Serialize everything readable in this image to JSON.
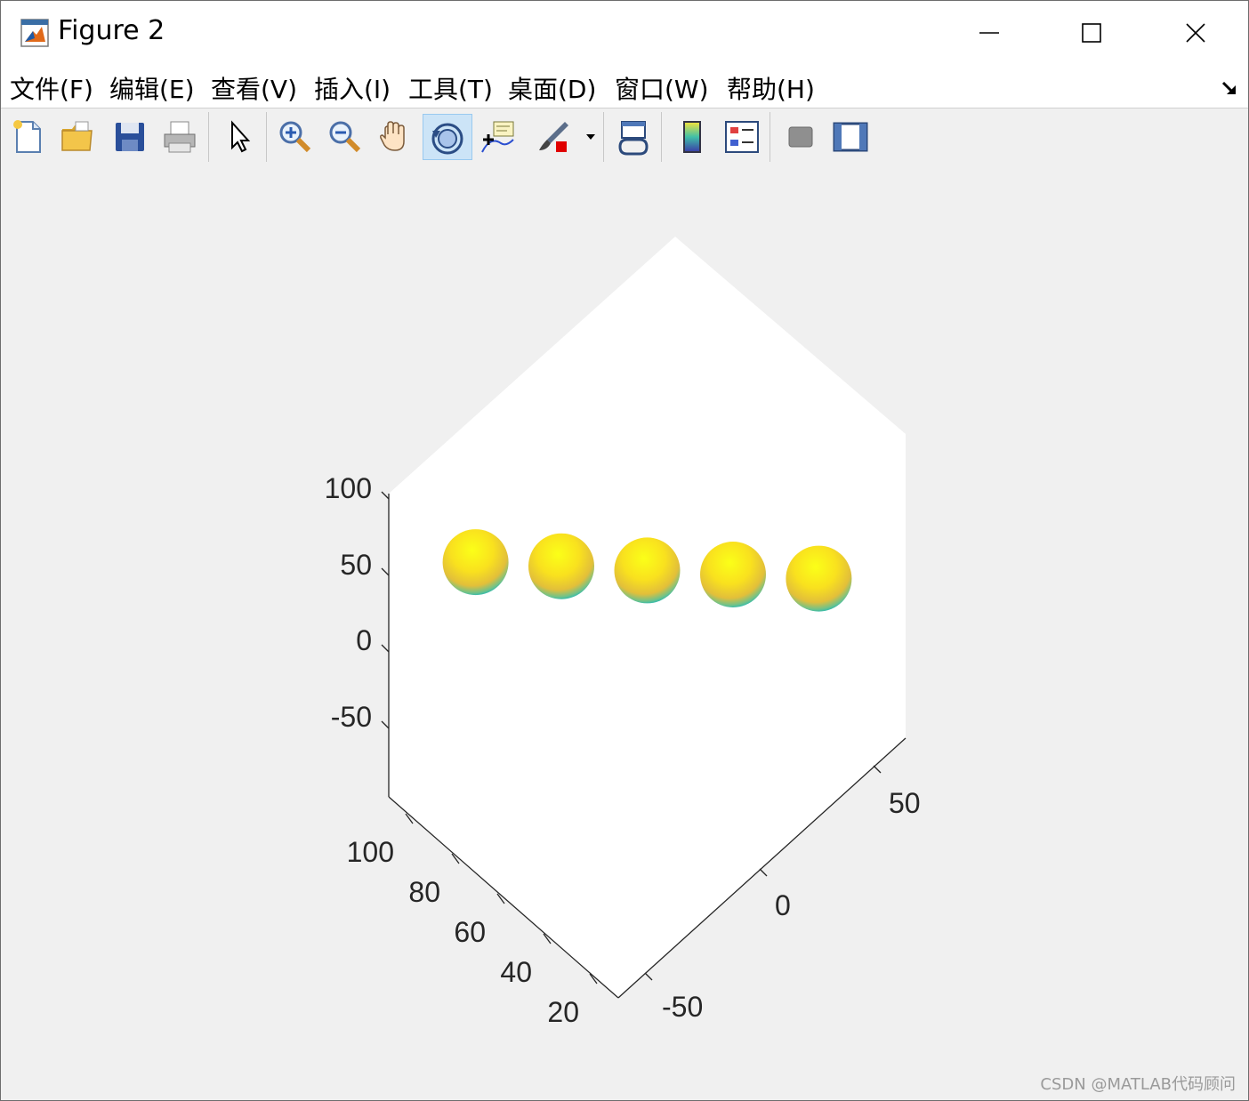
{
  "window": {
    "title": "Figure 2"
  },
  "menu": {
    "items": [
      "文件(F)",
      "编辑(E)",
      "查看(V)",
      "插入(I)",
      "工具(T)",
      "桌面(D)",
      "窗口(W)",
      "帮助(H)"
    ]
  },
  "toolbar": {
    "buttons": [
      "new-figure",
      "open-file",
      "save-figure",
      "print-figure",
      "edit-plot-arrow",
      "zoom-in",
      "zoom-out",
      "pan-hand",
      "rotate-3d",
      "data-cursor",
      "brush",
      "link-plot",
      "insert-colorbar",
      "insert-legend",
      "hide-plot-tools",
      "show-plot-tools"
    ],
    "active": "rotate-3d"
  },
  "chart_data": {
    "type": "scatter3d",
    "title": "",
    "z_ticks": [
      "100",
      "50",
      "0",
      "-50"
    ],
    "x_ticks": [
      "100",
      "80",
      "60",
      "40",
      "20"
    ],
    "y_ticks": [
      "50",
      "0",
      "-50"
    ],
    "spheres": [
      {
        "x": 100,
        "y": -50,
        "z": 30
      },
      {
        "x": 80,
        "y": -25,
        "z": 30
      },
      {
        "x": 60,
        "y": 0,
        "z": 30
      },
      {
        "x": 40,
        "y": 25,
        "z": 30
      },
      {
        "x": 20,
        "y": 50,
        "z": 30
      }
    ],
    "colormap": [
      "#00b4c8",
      "#f9e11e",
      "#fbff18"
    ],
    "axes_background": "#ffffff",
    "figure_background": "#f0f0f0"
  },
  "watermark": "CSDN @MATLAB代码顾问"
}
